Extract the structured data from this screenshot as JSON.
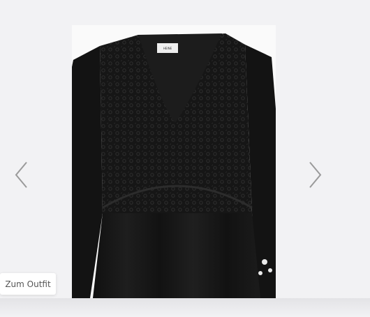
{
  "gallery": {
    "image_alt": "Black lace blouse dress",
    "label_brand": "HEINE",
    "prev_icon": "chevron-left-icon",
    "next_icon": "chevron-right-icon",
    "outfit_button_label": "Zum Outfit",
    "colors": {
      "background": "#f2f2f4",
      "garment": "#141414",
      "arrow": "#9a9a9a"
    }
  }
}
